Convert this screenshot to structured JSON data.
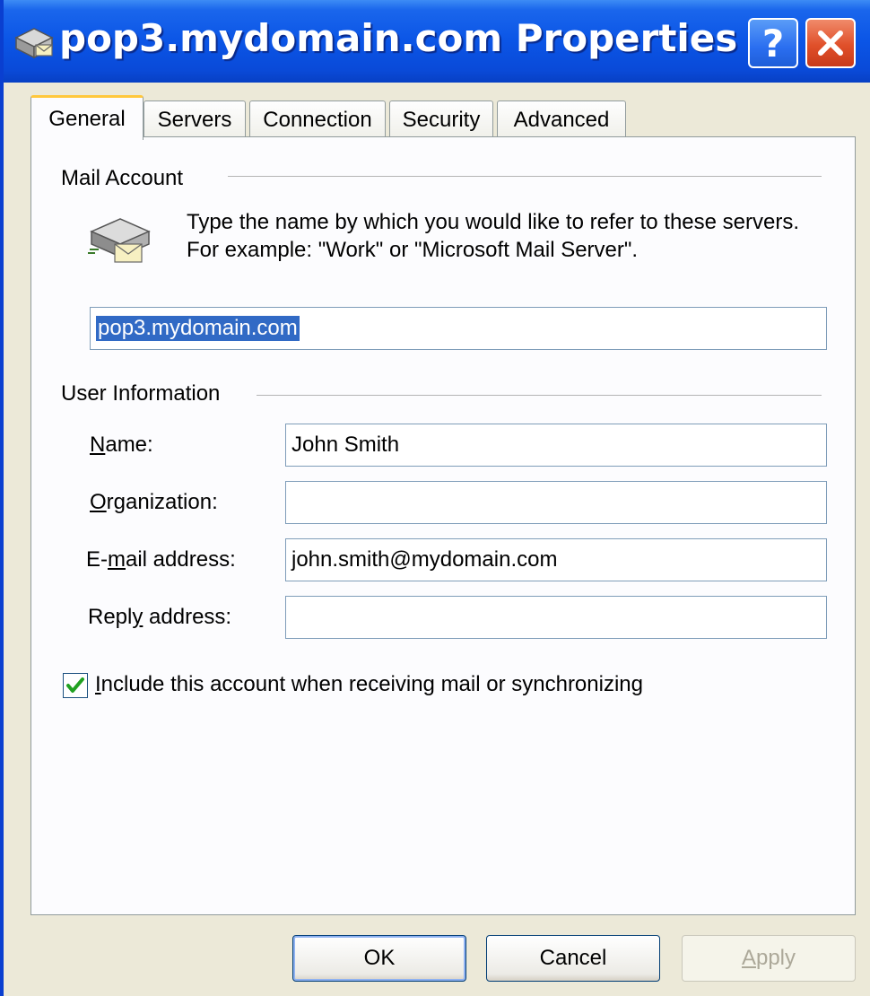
{
  "window": {
    "title": "pop3.mydomain.com Properties",
    "help_label": "?",
    "accent_color": "#0a4ad8",
    "close_color": "#e0502a"
  },
  "tabs": [
    {
      "label": "General",
      "active": true
    },
    {
      "label": "Servers",
      "active": false
    },
    {
      "label": "Connection",
      "active": false
    },
    {
      "label": "Security",
      "active": false
    },
    {
      "label": "Advanced",
      "active": false
    }
  ],
  "mail_account": {
    "section_label": "Mail Account",
    "icon": "mail-server-icon",
    "description": "Type the name by which you would like to refer to these servers.  For example: \"Work\" or \"Microsoft Mail Server\".",
    "account_name": "pop3.mydomain.com"
  },
  "user_info": {
    "section_label": "User Information",
    "name": {
      "label_mnemonic": "N",
      "label_rest": "ame:",
      "value": "John Smith"
    },
    "organization": {
      "label_mnemonic": "O",
      "label_rest": "rganization:",
      "value": ""
    },
    "email": {
      "label_pre": "E-",
      "label_mnemonic": "m",
      "label_rest": "ail address:",
      "value": "john.smith@mydomain.com"
    },
    "reply": {
      "label_pre": "Repl",
      "label_mnemonic": "y",
      "label_rest": " address:",
      "value": ""
    }
  },
  "include_checkbox": {
    "checked": true,
    "label_mnemonic": "I",
    "label_rest": "nclude this account when receiving mail or synchronizing"
  },
  "buttons": {
    "ok": "OK",
    "cancel": "Cancel",
    "apply_mnemonic": "A",
    "apply_rest": "pply",
    "apply_enabled": false
  }
}
